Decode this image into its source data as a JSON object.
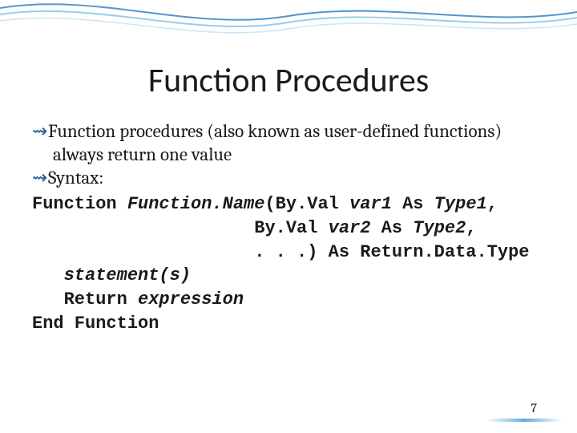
{
  "title": "Function Procedures",
  "bullets": [
    "Function procedures (also known as user-defined functions) always return one value",
    "Syntax:"
  ],
  "code": {
    "l1a": "Function ",
    "l1b": "Function.Name",
    "l1c": "(By.Val ",
    "l1d": "var1",
    "l1e": " As ",
    "l1f": "Type1",
    "l1g": ",",
    "l2a": "                     By.Val ",
    "l2b": "var2",
    "l2c": " As ",
    "l2d": "Type2",
    "l2e": ",",
    "l3": "                     . . .) As Return.Data.Type",
    "l4": "   statement(s)",
    "l5a": "   Return ",
    "l5b": "expression",
    "l6": "End Function"
  },
  "page_number": "7",
  "bullet_glyph": "⇝"
}
